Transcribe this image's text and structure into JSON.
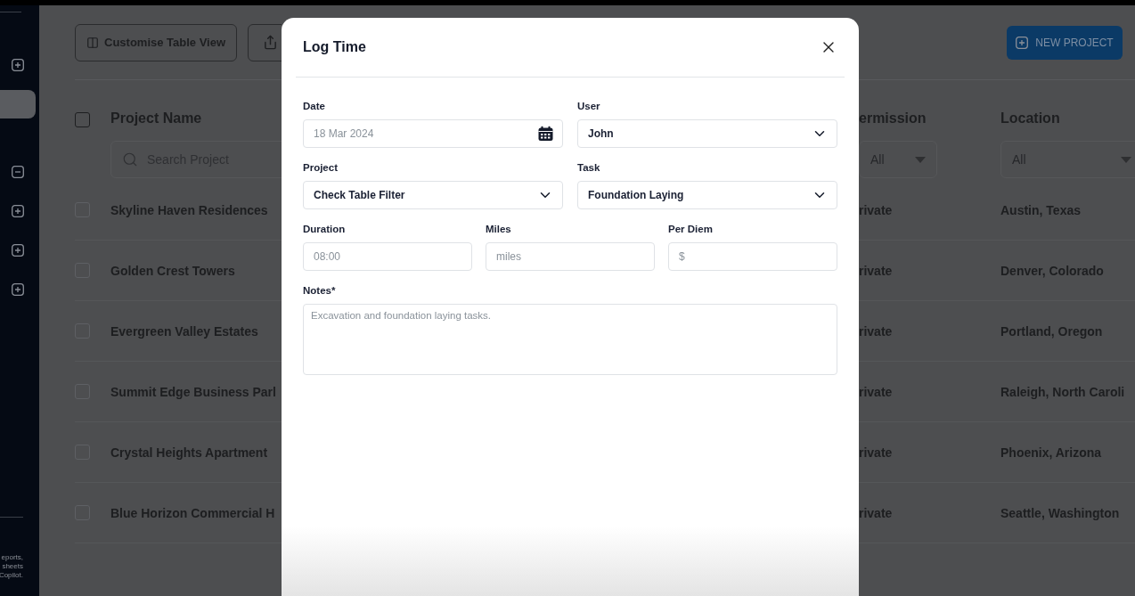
{
  "sidebar": {
    "items": [
      {
        "kind": "plus",
        "selected": false
      },
      {
        "kind": "blank",
        "selected": true
      },
      {
        "kind": "minus",
        "selected": false
      },
      {
        "kind": "plus",
        "selected": false
      },
      {
        "kind": "plus",
        "selected": false
      },
      {
        "kind": "plus",
        "selected": false
      }
    ],
    "footer_lines": [
      "eports,",
      "sheets",
      "Copilot."
    ]
  },
  "toolbar": {
    "customise_button": "Customise Table View",
    "new_project_button": "NEW PROJECT"
  },
  "table": {
    "select_all_checked": false,
    "columns": [
      {
        "label": "Project Name",
        "filter": {
          "kind": "search",
          "placeholder": "Search Project"
        }
      },
      {
        "label": "ermission",
        "filter": {
          "kind": "select",
          "value": "All"
        }
      },
      {
        "label": "Location",
        "filter": {
          "kind": "select",
          "value": "All"
        }
      }
    ],
    "rows": [
      {
        "checked": false,
        "project_name": "Skyline Haven Residences",
        "permission": "rivate",
        "location": "Austin, Texas"
      },
      {
        "checked": false,
        "project_name": "Golden Crest Towers",
        "permission": "rivate",
        "location": "Denver, Colorado"
      },
      {
        "checked": false,
        "project_name": "Evergreen Valley Estates",
        "permission": "rivate",
        "location": "Portland, Oregon"
      },
      {
        "checked": false,
        "project_name": "Summit Edge Business Parl",
        "permission": "rivate",
        "location": "Raleigh, North Caroli"
      },
      {
        "checked": false,
        "project_name": "Crystal Heights Apartment",
        "permission": "rivate",
        "location": "Phoenix, Arizona"
      },
      {
        "checked": false,
        "project_name": "Blue Horizon Commercial H",
        "permission": "rivate",
        "location": "Seattle, Washington"
      }
    ]
  },
  "modal": {
    "title": "Log Time",
    "form_rows": [
      [
        {
          "label": "Date",
          "kind": "date",
          "placeholder": "18 Mar 2024"
        },
        {
          "label": "User",
          "kind": "select",
          "value": "John"
        }
      ],
      [
        {
          "label": "Project",
          "kind": "select",
          "value": "Check Table Filter"
        },
        {
          "label": "Task",
          "kind": "select",
          "value": "Foundation Laying"
        }
      ],
      [
        {
          "label": "Duration",
          "kind": "text",
          "placeholder": "08:00"
        },
        {
          "label": "Miles",
          "kind": "text",
          "placeholder": "miles"
        },
        {
          "label": "Per Diem",
          "kind": "text",
          "placeholder": "$"
        }
      ],
      [
        {
          "label": "Notes*",
          "kind": "textarea",
          "placeholder": "Excavation and foundation laying tasks."
        }
      ]
    ]
  }
}
